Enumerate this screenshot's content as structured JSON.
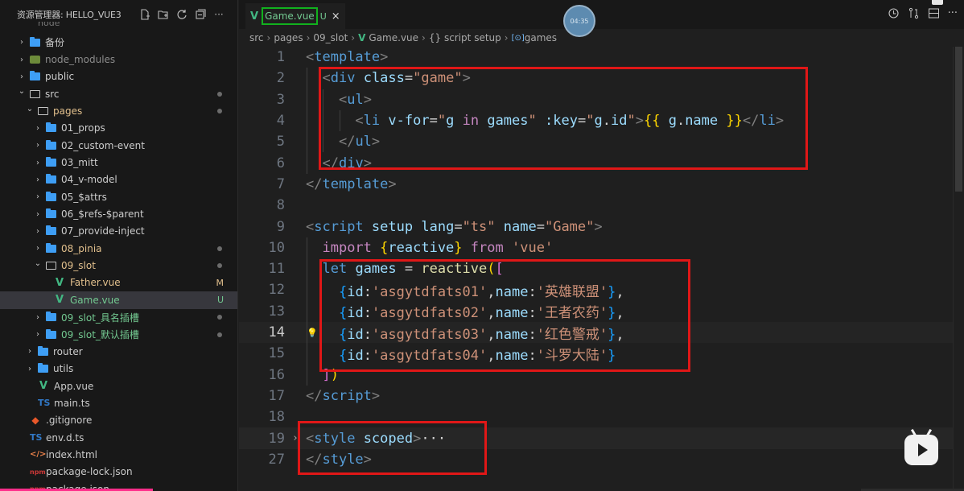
{
  "explorer": {
    "title": "资源管理器: HELLO_VUE3",
    "peek_text": "node",
    "actions": [
      "new-file-icon",
      "new-folder-icon",
      "refresh-icon",
      "collapse-icon",
      "more-icon"
    ]
  },
  "tree": [
    {
      "depth": 0,
      "kind": "folder",
      "open": false,
      "label": "备份",
      "color": "normal"
    },
    {
      "depth": 0,
      "kind": "nm",
      "open": false,
      "label": "node_modules",
      "color": "dim"
    },
    {
      "depth": 0,
      "kind": "folder",
      "open": false,
      "label": "public",
      "color": "normal"
    },
    {
      "depth": 0,
      "kind": "folder-open",
      "open": true,
      "label": "src",
      "color": "normal",
      "dot": true
    },
    {
      "depth": 1,
      "kind": "folder-open",
      "open": true,
      "label": "pages",
      "color": "yellow",
      "dot": true
    },
    {
      "depth": 2,
      "kind": "folder",
      "open": false,
      "label": "01_props",
      "color": "normal"
    },
    {
      "depth": 2,
      "kind": "folder",
      "open": false,
      "label": "02_custom-event",
      "color": "normal"
    },
    {
      "depth": 2,
      "kind": "folder",
      "open": false,
      "label": "03_mitt",
      "color": "normal"
    },
    {
      "depth": 2,
      "kind": "folder",
      "open": false,
      "label": "04_v-model",
      "color": "normal"
    },
    {
      "depth": 2,
      "kind": "folder",
      "open": false,
      "label": "05_$attrs",
      "color": "normal"
    },
    {
      "depth": 2,
      "kind": "folder",
      "open": false,
      "label": "06_$refs-$parent",
      "color": "normal"
    },
    {
      "depth": 2,
      "kind": "folder",
      "open": false,
      "label": "07_provide-inject",
      "color": "normal"
    },
    {
      "depth": 2,
      "kind": "folder",
      "open": false,
      "label": "08_pinia",
      "color": "yellow",
      "dot": true
    },
    {
      "depth": 2,
      "kind": "folder-open",
      "open": true,
      "label": "09_slot",
      "color": "yellow",
      "dot": true
    },
    {
      "depth": 3,
      "kind": "vue",
      "label": "Father.vue",
      "color": "yellow",
      "badge": "M"
    },
    {
      "depth": 3,
      "kind": "vue",
      "label": "Game.vue",
      "color": "green",
      "badge": "U",
      "selected": true
    },
    {
      "depth": 2,
      "kind": "folder",
      "open": false,
      "label": "09_slot_具名插槽",
      "color": "green",
      "dot": true
    },
    {
      "depth": 2,
      "kind": "folder",
      "open": false,
      "label": "09_slot_默认插槽",
      "color": "green",
      "dot": true
    },
    {
      "depth": 1,
      "kind": "folder",
      "open": false,
      "label": "router",
      "color": "normal"
    },
    {
      "depth": 1,
      "kind": "folder",
      "open": false,
      "label": "utils",
      "color": "normal"
    },
    {
      "depth": 1,
      "kind": "vue",
      "label": "App.vue",
      "color": "normal"
    },
    {
      "depth": 1,
      "kind": "ts",
      "label": "main.ts",
      "color": "normal"
    },
    {
      "depth": 0,
      "kind": "git",
      "label": ".gitignore",
      "color": "normal"
    },
    {
      "depth": 0,
      "kind": "ts",
      "label": "env.d.ts",
      "color": "normal"
    },
    {
      "depth": 0,
      "kind": "html",
      "label": "index.html",
      "color": "normal"
    },
    {
      "depth": 0,
      "kind": "npm",
      "label": "package-lock.json",
      "color": "normal"
    },
    {
      "depth": 0,
      "kind": "npm",
      "label": "package.json",
      "color": "normal"
    }
  ],
  "tab": {
    "name": "Game.vue",
    "status": "U",
    "close": "×"
  },
  "timer": "04:35",
  "breadcrumb": [
    "src",
    "pages",
    "09_slot",
    "Game.vue",
    "{} script setup",
    "games"
  ],
  "code_lines": [
    {
      "n": "1",
      "tokens": [
        [
          "t-punct",
          "<"
        ],
        [
          "t-tag",
          "template"
        ],
        [
          "t-punct",
          ">"
        ]
      ]
    },
    {
      "n": "2",
      "tokens": [
        [
          "t-text",
          "  "
        ],
        [
          "t-punct",
          "<"
        ],
        [
          "t-tag",
          "div"
        ],
        [
          "t-text",
          " "
        ],
        [
          "t-attr",
          "class"
        ],
        [
          "t-text",
          "="
        ],
        [
          "t-str",
          "\"game\""
        ],
        [
          "t-punct",
          ">"
        ]
      ]
    },
    {
      "n": "3",
      "tokens": [
        [
          "t-text",
          "    "
        ],
        [
          "t-punct",
          "<"
        ],
        [
          "t-tag",
          "ul"
        ],
        [
          "t-punct",
          ">"
        ]
      ]
    },
    {
      "n": "4",
      "tokens": [
        [
          "t-text",
          "      "
        ],
        [
          "t-punct",
          "<"
        ],
        [
          "t-tag",
          "li"
        ],
        [
          "t-text",
          " "
        ],
        [
          "t-attr",
          "v-for"
        ],
        [
          "t-text",
          "="
        ],
        [
          "t-str",
          "\""
        ],
        [
          "t-var",
          "g"
        ],
        [
          "t-text",
          " "
        ],
        [
          "t-ctrl",
          "in"
        ],
        [
          "t-text",
          " "
        ],
        [
          "t-var",
          "games"
        ],
        [
          "t-str",
          "\""
        ],
        [
          "t-text",
          " "
        ],
        [
          "t-attr",
          ":key"
        ],
        [
          "t-text",
          "="
        ],
        [
          "t-str",
          "\""
        ],
        [
          "t-var",
          "g"
        ],
        [
          "t-text",
          "."
        ],
        [
          "t-var",
          "id"
        ],
        [
          "t-str",
          "\""
        ],
        [
          "t-punct",
          ">"
        ],
        [
          "t-brace",
          "{{"
        ],
        [
          "t-text",
          " "
        ],
        [
          "t-var",
          "g"
        ],
        [
          "t-text",
          "."
        ],
        [
          "t-var",
          "name"
        ],
        [
          "t-text",
          " "
        ],
        [
          "t-brace",
          "}}"
        ],
        [
          "t-punct",
          "</"
        ],
        [
          "t-tag",
          "li"
        ],
        [
          "t-punct",
          ">"
        ]
      ]
    },
    {
      "n": "5",
      "tokens": [
        [
          "t-text",
          "    "
        ],
        [
          "t-punct",
          "</"
        ],
        [
          "t-tag",
          "ul"
        ],
        [
          "t-punct",
          ">"
        ]
      ]
    },
    {
      "n": "6",
      "tokens": [
        [
          "t-text",
          "  "
        ],
        [
          "t-punct",
          "</"
        ],
        [
          "t-tag",
          "div"
        ],
        [
          "t-punct",
          ">"
        ]
      ]
    },
    {
      "n": "7",
      "tokens": [
        [
          "t-punct",
          "</"
        ],
        [
          "t-tag",
          "template"
        ],
        [
          "t-punct",
          ">"
        ]
      ]
    },
    {
      "n": "8",
      "tokens": []
    },
    {
      "n": "9",
      "tokens": [
        [
          "t-punct",
          "<"
        ],
        [
          "t-tag",
          "script"
        ],
        [
          "t-text",
          " "
        ],
        [
          "t-attr",
          "setup"
        ],
        [
          "t-text",
          " "
        ],
        [
          "t-attr",
          "lang"
        ],
        [
          "t-text",
          "="
        ],
        [
          "t-str",
          "\"ts\""
        ],
        [
          "t-text",
          " "
        ],
        [
          "t-attr",
          "name"
        ],
        [
          "t-text",
          "="
        ],
        [
          "t-str",
          "\"Game\""
        ],
        [
          "t-punct",
          ">"
        ]
      ]
    },
    {
      "n": "10",
      "tokens": [
        [
          "t-text",
          "  "
        ],
        [
          "t-ctrl",
          "import"
        ],
        [
          "t-text",
          " "
        ],
        [
          "t-brace",
          "{"
        ],
        [
          "t-var",
          "reactive"
        ],
        [
          "t-brace",
          "}"
        ],
        [
          "t-text",
          " "
        ],
        [
          "t-ctrl",
          "from"
        ],
        [
          "t-text",
          " "
        ],
        [
          "t-str",
          "'vue'"
        ]
      ]
    },
    {
      "n": "11",
      "tokens": [
        [
          "t-text",
          "  "
        ],
        [
          "t-kw",
          "let"
        ],
        [
          "t-text",
          " "
        ],
        [
          "t-var",
          "games"
        ],
        [
          "t-text",
          " = "
        ],
        [
          "t-fn",
          "reactive"
        ],
        [
          "t-brace",
          "("
        ],
        [
          "t-paren",
          "["
        ]
      ]
    },
    {
      "n": "12",
      "tokens": [
        [
          "t-text",
          "    "
        ],
        [
          "t-brack",
          "{"
        ],
        [
          "t-var",
          "id"
        ],
        [
          "t-text",
          ":"
        ],
        [
          "t-str",
          "'asgytdfats01'"
        ],
        [
          "t-text",
          ","
        ],
        [
          "t-var",
          "name"
        ],
        [
          "t-text",
          ":"
        ],
        [
          "t-str",
          "'英雄联盟'"
        ],
        [
          "t-brack",
          "}"
        ],
        [
          "t-text",
          ","
        ]
      ]
    },
    {
      "n": "13",
      "tokens": [
        [
          "t-text",
          "    "
        ],
        [
          "t-brack",
          "{"
        ],
        [
          "t-var",
          "id"
        ],
        [
          "t-text",
          ":"
        ],
        [
          "t-str",
          "'asgytdfats02'"
        ],
        [
          "t-text",
          ","
        ],
        [
          "t-var",
          "name"
        ],
        [
          "t-text",
          ":"
        ],
        [
          "t-str",
          "'王者农药'"
        ],
        [
          "t-brack",
          "}"
        ],
        [
          "t-text",
          ","
        ]
      ]
    },
    {
      "n": "14",
      "tokens": [
        [
          "t-text",
          "    "
        ],
        [
          "t-brack",
          "{"
        ],
        [
          "t-var",
          "id"
        ],
        [
          "t-text",
          ":"
        ],
        [
          "t-str",
          "'asgytdfats03'"
        ],
        [
          "t-text",
          ","
        ],
        [
          "t-var",
          "name"
        ],
        [
          "t-text",
          ":"
        ],
        [
          "t-str",
          "'红色警戒'"
        ],
        [
          "t-brack",
          "}"
        ],
        [
          "t-text",
          ","
        ]
      ]
    },
    {
      "n": "15",
      "tokens": [
        [
          "t-text",
          "    "
        ],
        [
          "t-brack",
          "{"
        ],
        [
          "t-var",
          "id"
        ],
        [
          "t-text",
          ":"
        ],
        [
          "t-str",
          "'asgytdfats04'"
        ],
        [
          "t-text",
          ","
        ],
        [
          "t-var",
          "name"
        ],
        [
          "t-text",
          ":"
        ],
        [
          "t-str",
          "'斗罗大陆'"
        ],
        [
          "t-brack",
          "}"
        ]
      ]
    },
    {
      "n": "16",
      "tokens": [
        [
          "t-text",
          "  "
        ],
        [
          "t-paren",
          "]"
        ],
        [
          "t-brace",
          ")"
        ]
      ]
    },
    {
      "n": "17",
      "tokens": [
        [
          "t-punct",
          "</"
        ],
        [
          "t-tag",
          "script"
        ],
        [
          "t-punct",
          ">"
        ]
      ]
    },
    {
      "n": "18",
      "tokens": []
    },
    {
      "n": "19",
      "tokens": [
        [
          "t-punct",
          "<"
        ],
        [
          "t-tag",
          "style"
        ],
        [
          "t-text",
          " "
        ],
        [
          "t-attr",
          "scoped"
        ],
        [
          "t-punct",
          ">"
        ],
        [
          "t-text",
          "···"
        ]
      ]
    },
    {
      "n": "27",
      "tokens": [
        [
          "t-punct",
          "</"
        ],
        [
          "t-tag",
          "style"
        ],
        [
          "t-punct",
          ">"
        ]
      ]
    }
  ],
  "active_line": "14",
  "icons": {
    "explorer_new_file": "new-file-icon",
    "explorer_new_folder": "new-folder-icon",
    "explorer_refresh": "refresh-icon",
    "explorer_collapse": "collapse-icon",
    "explorer_more": "more-icon",
    "lightbulb": "lightbulb-icon",
    "fold": "chevron-right-icon"
  },
  "colors": {
    "highlight_box": "#e01717",
    "tab_highlight": "#11b11e"
  }
}
